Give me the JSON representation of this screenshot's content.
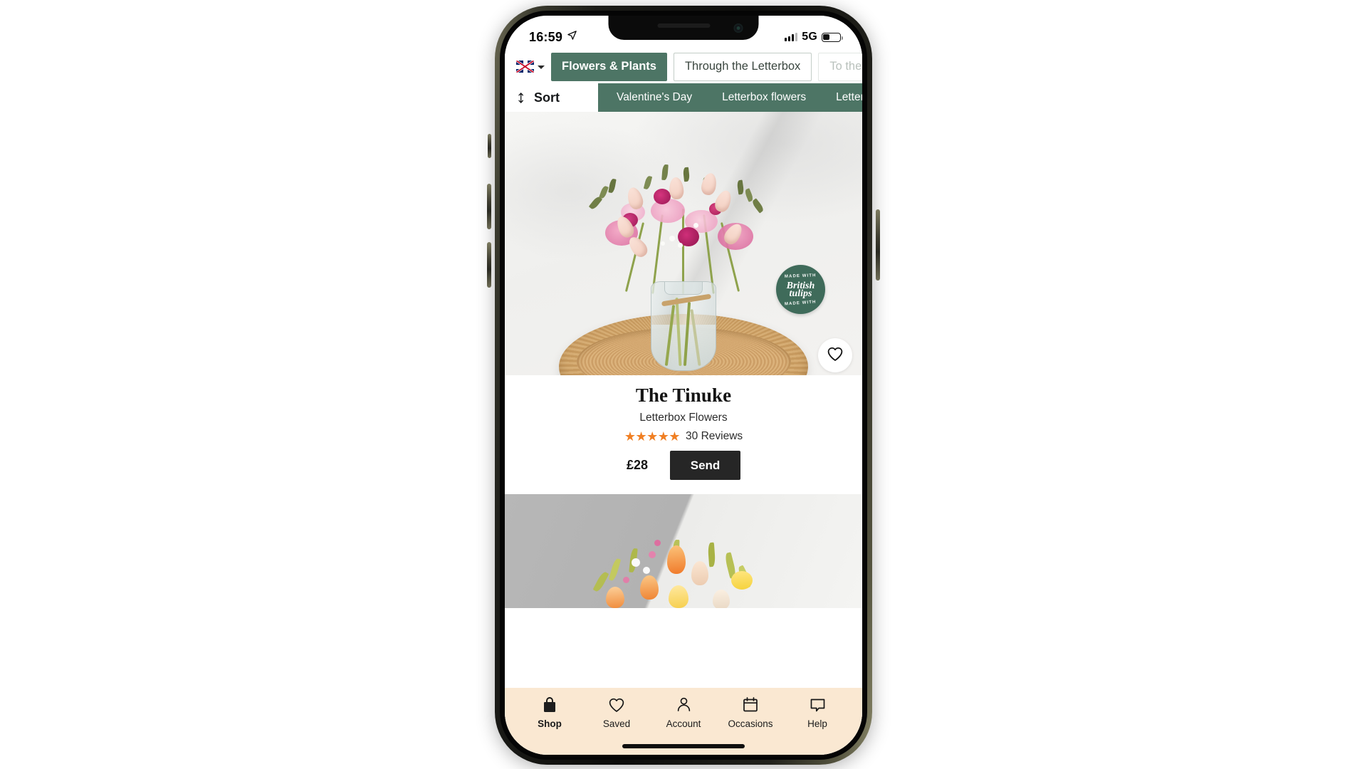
{
  "status_bar": {
    "time": "16:59",
    "location_icon": "location-arrow-icon",
    "signal_icon": "cellular-bars-icon",
    "network": "5G",
    "battery_icon": "battery-icon"
  },
  "locale": {
    "flag_icon": "uk-flag-icon",
    "chevron_icon": "chevron-down-icon"
  },
  "categories": [
    {
      "label": "Flowers & Plants",
      "state": "active"
    },
    {
      "label": "Through the Letterbox",
      "state": "idle"
    },
    {
      "label": "To the d",
      "state": "faded"
    }
  ],
  "sort": {
    "label": "Sort",
    "icon": "sort-arrows-icon"
  },
  "subnav": [
    {
      "label": "Valentine's Day"
    },
    {
      "label": "Letterbox flowers"
    },
    {
      "label": "Letterbox p"
    }
  ],
  "products": [
    {
      "title": "The Tinuke",
      "subtitle": "Letterbox Flowers",
      "stars": "★★★★★",
      "rating_value": 5,
      "reviews": "30 Reviews",
      "price": "£28",
      "send_label": "Send",
      "fav_icon": "heart-outline-icon",
      "badge": {
        "arc_top": "MADE WITH",
        "main_line1": "British",
        "main_line2": "tulips",
        "arc_bottom": "MADE WITH"
      }
    },
    {
      "title": "",
      "subtitle": "",
      "price": "",
      "send_label": ""
    }
  ],
  "tabbar": [
    {
      "label": "Shop",
      "icon": "shopping-bag-icon",
      "active": true
    },
    {
      "label": "Saved",
      "icon": "heart-outline-icon",
      "active": false
    },
    {
      "label": "Account",
      "icon": "person-icon",
      "active": false
    },
    {
      "label": "Occasions",
      "icon": "calendar-icon",
      "active": false
    },
    {
      "label": "Help",
      "icon": "chat-bubble-icon",
      "active": false
    }
  ],
  "colors": {
    "brand_green": "#4d7565",
    "badge_green": "#3f6b5a",
    "tabbar_cream": "#fae8d2",
    "star_orange": "#F07F23",
    "send_dark": "#262626"
  }
}
